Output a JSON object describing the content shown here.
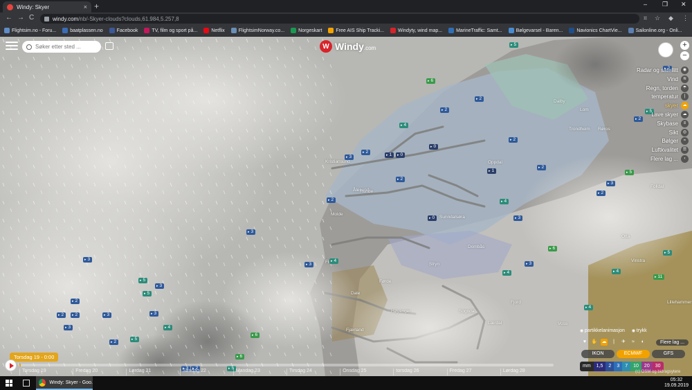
{
  "browser": {
    "tab_title": "Windy: Skyer",
    "tab_close": "×",
    "new_tab": "+",
    "url_host": "windy.com",
    "url_path": "/nb/-Skyer-clouds?clouds,61.984,5.257,8",
    "nav": {
      "back": "←",
      "forward": "→",
      "reload": "C"
    },
    "window_controls": [
      "–",
      "❐",
      "✕"
    ],
    "bookmarks": [
      {
        "label": "Flightsim.no - Foru...",
        "color": "#5f8ec7"
      },
      {
        "label": "baatplassen.no",
        "color": "#3a6db5"
      },
      {
        "label": "Facebook",
        "color": "#3b5998"
      },
      {
        "label": "TV, film og sport på...",
        "color": "#c2185b"
      },
      {
        "label": "Netflix",
        "color": "#e50914"
      },
      {
        "label": "FlightsimNorway.co...",
        "color": "#6b8fb5"
      },
      {
        "label": "Norgeskart",
        "color": "#1a9850"
      },
      {
        "label": "Free AIS Ship Tracki...",
        "color": "#f4a300"
      },
      {
        "label": "Windyty, wind map...",
        "color": "#d8232a"
      },
      {
        "label": "MarineTraffic: Samt...",
        "color": "#2f6fb5"
      },
      {
        "label": "Bølgevarsel - Baren...",
        "color": "#4a8bd0"
      },
      {
        "label": "Navionics ChartVie...",
        "color": "#1f4f8a"
      },
      {
        "label": "Sailonline.org - Onli...",
        "color": "#5b7fb0"
      }
    ]
  },
  "windy": {
    "search_placeholder": "Søker etter sted ...",
    "logo_text": "Windy",
    "logo_suffix": ".com",
    "logo_mark": "W",
    "zoom_in": "+",
    "zoom_out": "−",
    "layers": [
      "Radar og satellitt",
      "Vind",
      "Regn, torden",
      "temperatur",
      "skyer",
      "Lave skyer",
      "Skybase",
      "Sikt",
      "Bølger",
      "Luftkvalitet",
      "Flere lag ..."
    ],
    "active_layer": "skyer",
    "particle_anim": "partikkelanimasjon",
    "pressure": "trykk",
    "more_layers": "Flere lag ...",
    "models": [
      "IKON",
      "ECMWF",
      "GFS"
    ],
    "active_model": "ECMWF",
    "legend": {
      "unit": "mm",
      "values": [
        "1,5",
        "2",
        "3",
        "7",
        "10",
        "20",
        "30"
      ],
      "colors": [
        "#2b2b7a",
        "#2b4f9a",
        "#2d6fb8",
        "#2f8fb0",
        "#35a46a",
        "#9a3a8a",
        "#b82d6a"
      ]
    },
    "copyright": "(c) OSM og bidragsytere"
  },
  "timeline": {
    "current": "Torsdag 19 - 0:00",
    "days": [
      "Torsdag 19",
      "Fredag 20",
      "Lørdag 21",
      "Søndag 22",
      "Mandag 23",
      "Tirsdag 24",
      "Onsdag 25",
      "torsdag 26",
      "Fredag 27",
      "Lørdag 28"
    ]
  },
  "places": [
    "Kristiansund",
    "Molde",
    "Ålesund",
    "Runde",
    "Sunndalsøra",
    "Oppdal",
    "Dombås",
    "Stryn",
    "Florø",
    "Førde",
    "Dale",
    "Høyanger",
    "Sogndal",
    "Lærdal",
    "Fjærland",
    "Voss",
    "Fjord",
    "Otta",
    "Vinstra",
    "Dalby",
    "Lom",
    "Folldal",
    "Trondheim",
    "Røros",
    "Lillehammer"
  ],
  "wind_markers": [
    {
      "v": "5",
      "c": "m-teal"
    },
    {
      "v": "2",
      "c": "m-blue"
    },
    {
      "v": "6",
      "c": "m-green"
    },
    {
      "v": "2",
      "c": "m-blue"
    },
    {
      "v": "2",
      "c": "m-blue"
    },
    {
      "v": "4",
      "c": "m-teal"
    },
    {
      "v": "5",
      "c": "m-teal"
    },
    {
      "v": "2",
      "c": "m-blue"
    },
    {
      "v": "2",
      "c": "m-blue"
    },
    {
      "v": "3",
      "c": "m-blue"
    },
    {
      "v": "2",
      "c": "m-blue"
    },
    {
      "v": "1",
      "c": "m-dark"
    },
    {
      "v": "0",
      "c": "m-dark"
    },
    {
      "v": "0",
      "c": "m-dark"
    },
    {
      "v": "1",
      "c": "m-dark"
    },
    {
      "v": "2",
      "c": "m-blue"
    },
    {
      "v": "5",
      "c": "m-green"
    },
    {
      "v": "3",
      "c": "m-blue"
    },
    {
      "v": "2",
      "c": "m-blue"
    },
    {
      "v": "2",
      "c": "m-blue"
    },
    {
      "v": "4",
      "c": "m-teal"
    },
    {
      "v": "2",
      "c": "m-blue"
    },
    {
      "v": "3",
      "c": "m-blue"
    },
    {
      "v": "0",
      "c": "m-dark"
    },
    {
      "v": "6",
      "c": "m-green"
    },
    {
      "v": "3",
      "c": "m-blue"
    },
    {
      "v": "4",
      "c": "m-teal"
    },
    {
      "v": "3",
      "c": "m-blue"
    },
    {
      "v": "3",
      "c": "m-blue"
    },
    {
      "v": "4",
      "c": "m-teal"
    },
    {
      "v": "3",
      "c": "m-blue"
    },
    {
      "v": "5",
      "c": "m-teal"
    },
    {
      "v": "3",
      "c": "m-blue"
    },
    {
      "v": "5",
      "c": "m-teal"
    },
    {
      "v": "3",
      "c": "m-blue"
    },
    {
      "v": "2",
      "c": "m-blue"
    },
    {
      "v": "2",
      "c": "m-blue"
    },
    {
      "v": "2",
      "c": "m-blue"
    },
    {
      "v": "3",
      "c": "m-blue"
    },
    {
      "v": "3",
      "c": "m-blue"
    },
    {
      "v": "4",
      "c": "m-teal"
    },
    {
      "v": "2",
      "c": "m-blue"
    },
    {
      "v": "5",
      "c": "m-teal"
    },
    {
      "v": "2",
      "c": "m-blue"
    },
    {
      "v": "6",
      "c": "m-green"
    },
    {
      "v": "5",
      "c": "m-teal"
    },
    {
      "v": "3",
      "c": "m-blue"
    },
    {
      "v": "4",
      "c": "m-teal"
    },
    {
      "v": "5",
      "c": "m-teal"
    },
    {
      "v": "11",
      "c": "m-green"
    },
    {
      "v": "4",
      "c": "m-teal"
    },
    {
      "v": "6",
      "c": "m-green"
    }
  ],
  "taskbar": {
    "app_label": "Windy: Skyer - Goo...",
    "time": "05:32",
    "date": "19.09.2019"
  }
}
